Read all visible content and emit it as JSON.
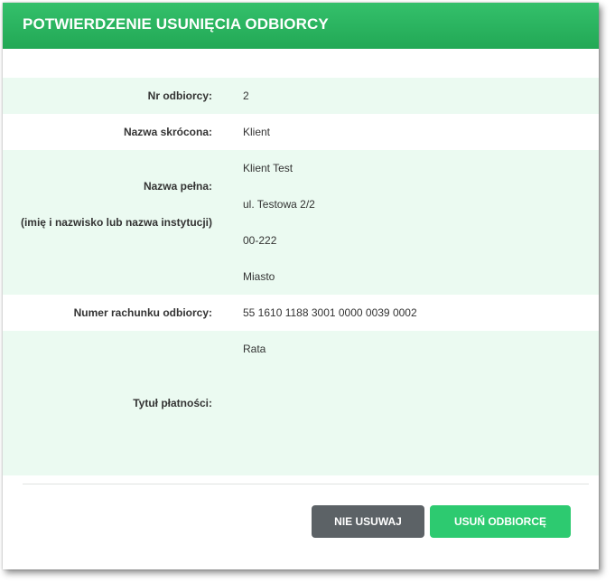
{
  "dialog": {
    "title": "POTWIERDZENIE USUNIĘCIA ODBIORCY"
  },
  "fields": {
    "nr_label": "Nr odbiorcy:",
    "nr_value": "2",
    "short_name_label": "Nazwa skrócona:",
    "short_name_value": "Klient",
    "full_name_label": "Nazwa pełna:",
    "full_name_sublabel": "(imię i nazwisko lub nazwa instytucji)",
    "full_name_lines": [
      "Klient Test",
      "ul. Testowa 2/2",
      "00-222",
      "Miasto"
    ],
    "account_label": "Numer rachunku odbiorcy:",
    "account_value": "55 1610 1188 3001 0000 0039 0002",
    "title_label": "Tytuł płatności:",
    "title_value": "Rata"
  },
  "buttons": {
    "cancel_label": "NIE USUWAJ",
    "confirm_label": "USUŃ ODBIORCĘ"
  },
  "colors": {
    "header_green": "#2bb45f",
    "row_shade": "#ebfaf1",
    "cancel_button": "#5c6266",
    "confirm_button": "#2dca70"
  }
}
